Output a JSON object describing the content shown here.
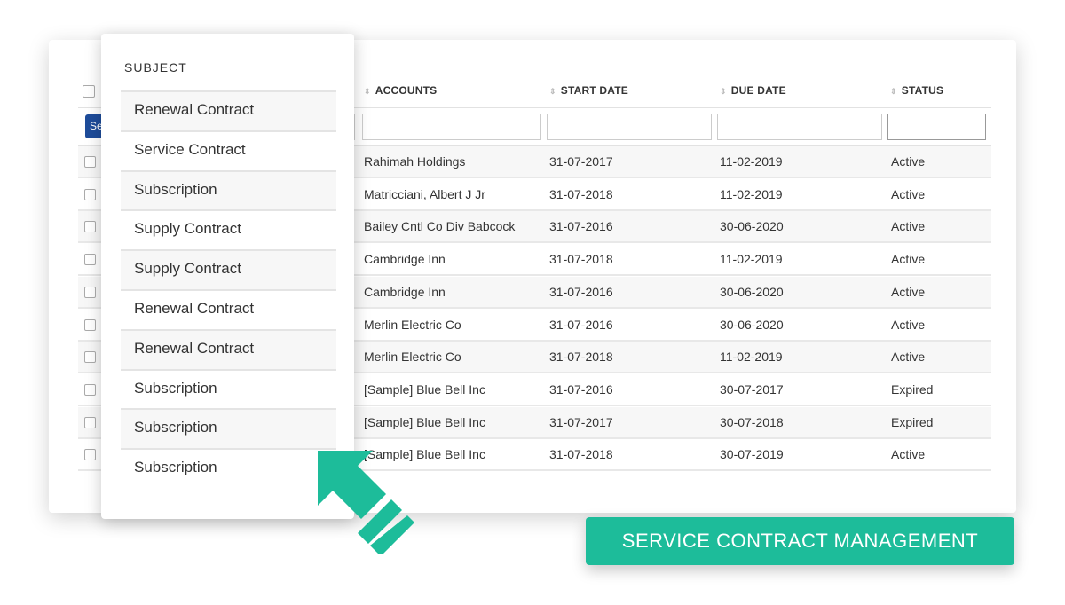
{
  "table": {
    "select_button_label": "Se",
    "columns": [
      {
        "label": "ACCOUNTS"
      },
      {
        "label": "START DATE"
      },
      {
        "label": "DUE DATE"
      },
      {
        "label": "STATUS"
      }
    ],
    "filters": {
      "accounts": "",
      "start_date": "",
      "due_date": "",
      "status": ""
    },
    "rows": [
      {
        "account": "Rahimah Holdings",
        "start": "31-07-2017",
        "due": "11-02-2019",
        "status": "Active"
      },
      {
        "account": "Matricciani, Albert J Jr",
        "start": "31-07-2018",
        "due": "11-02-2019",
        "status": "Active"
      },
      {
        "account": "Bailey Cntl Co Div Babcock",
        "start": "31-07-2016",
        "due": "30-06-2020",
        "status": "Active"
      },
      {
        "account": "Cambridge Inn",
        "start": "31-07-2018",
        "due": "11-02-2019",
        "status": "Active"
      },
      {
        "account": "Cambridge Inn",
        "start": "31-07-2016",
        "due": "30-06-2020",
        "status": "Active"
      },
      {
        "account": "Merlin Electric Co",
        "start": "31-07-2016",
        "due": "30-06-2020",
        "status": "Active"
      },
      {
        "account": "Merlin Electric Co",
        "start": "31-07-2018",
        "due": "11-02-2019",
        "status": "Active"
      },
      {
        "account": "[Sample] Blue Bell Inc",
        "start": "31-07-2016",
        "due": "30-07-2017",
        "status": "Expired"
      },
      {
        "account": "[Sample] Blue Bell Inc",
        "start": "31-07-2017",
        "due": "30-07-2018",
        "status": "Expired"
      },
      {
        "account": "[Sample] Blue Bell Inc",
        "start": "31-07-2018",
        "due": "30-07-2019",
        "status": "Active"
      }
    ]
  },
  "subject_panel": {
    "title": "SUBJECT",
    "items": [
      "Renewal Contract",
      "Service Contract",
      "Subscription",
      "Supply Contract",
      "Supply Contract",
      "Renewal Contract",
      "Renewal Contract",
      "Subscription",
      "Subscription",
      "Subscription"
    ]
  },
  "banner": {
    "label": "SERVICE CONTRACT MANAGEMENT"
  },
  "colors": {
    "accent": "#1dbc9a",
    "select_button": "#1e4c9a"
  }
}
